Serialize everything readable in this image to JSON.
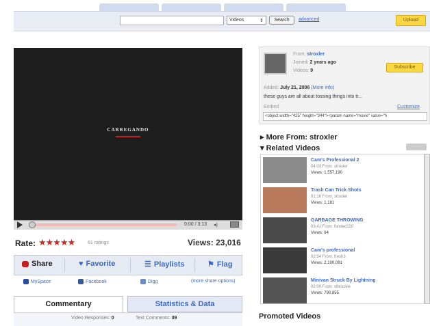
{
  "search": {
    "category": "Videos",
    "button": "Search",
    "advanced_link": "advanced",
    "upload_button": "Upload"
  },
  "player": {
    "loading_text": "CARREGANDO",
    "time": "0:00 / 3:13"
  },
  "rating": {
    "label": "Rate:",
    "ratings_count": "61 ratings",
    "views": "Views: 23,016"
  },
  "actions": [
    {
      "label": "Share"
    },
    {
      "label": "Favorite"
    },
    {
      "label": "Playlists"
    },
    {
      "label": "Flag"
    }
  ],
  "social": [
    {
      "label": "MySpace"
    },
    {
      "label": "Facebook"
    },
    {
      "label": "Digg"
    },
    {
      "label": "(more share options)"
    }
  ],
  "tabs": {
    "commentary": "Commentary",
    "stats": "Statistics & Data"
  },
  "comments_bar": {
    "responses_label": "Video Responses:",
    "responses_value": "0",
    "comments_label": "Text Comments:",
    "comments_value": "39"
  },
  "uploader": {
    "from_label": "From:",
    "name": "stroxler",
    "joined_label": "Joined:",
    "joined": "2 years ago",
    "videos_label": "Videos:",
    "videos": "9",
    "subscribe_button": "Subscribe",
    "added_label": "Added:",
    "added_date": "July 21, 2006",
    "more_info": "(More info)",
    "description": "these guys are all about tossing things into tr...",
    "embed_label": "Embed",
    "customize": "Customize",
    "embed_code": "<object width=\"425\" height=\"344\"><param name=\"movie\" value=\"h"
  },
  "sections": {
    "more_from": "More From: stroxler",
    "related": "Related Videos",
    "promoted": "Promoted Videos"
  },
  "related_videos": [
    {
      "title": "Cam's Professional 2",
      "meta": "04:03 From: stroxler",
      "views": "Views: 1,557,190"
    },
    {
      "title": "Trash Can Trick Shots",
      "meta": "01:16 From: stroxler",
      "views": "Views: 1,181"
    },
    {
      "title": "GARBAGE THROWING",
      "meta": "03:41 From: funded120",
      "views": "Views: 64"
    },
    {
      "title": "Cam's professional",
      "meta": "02:54 From: fresh3",
      "views": "Views: 2,100,091"
    },
    {
      "title": "Minivan Struck By Lightning",
      "meta": "02:09 From: stbrockie",
      "views": "Views: 790,855"
    }
  ],
  "colors": {
    "link_blue": "#3b68c4",
    "star_red": "#c62b1f",
    "upload_yellow": "#fbd744"
  }
}
